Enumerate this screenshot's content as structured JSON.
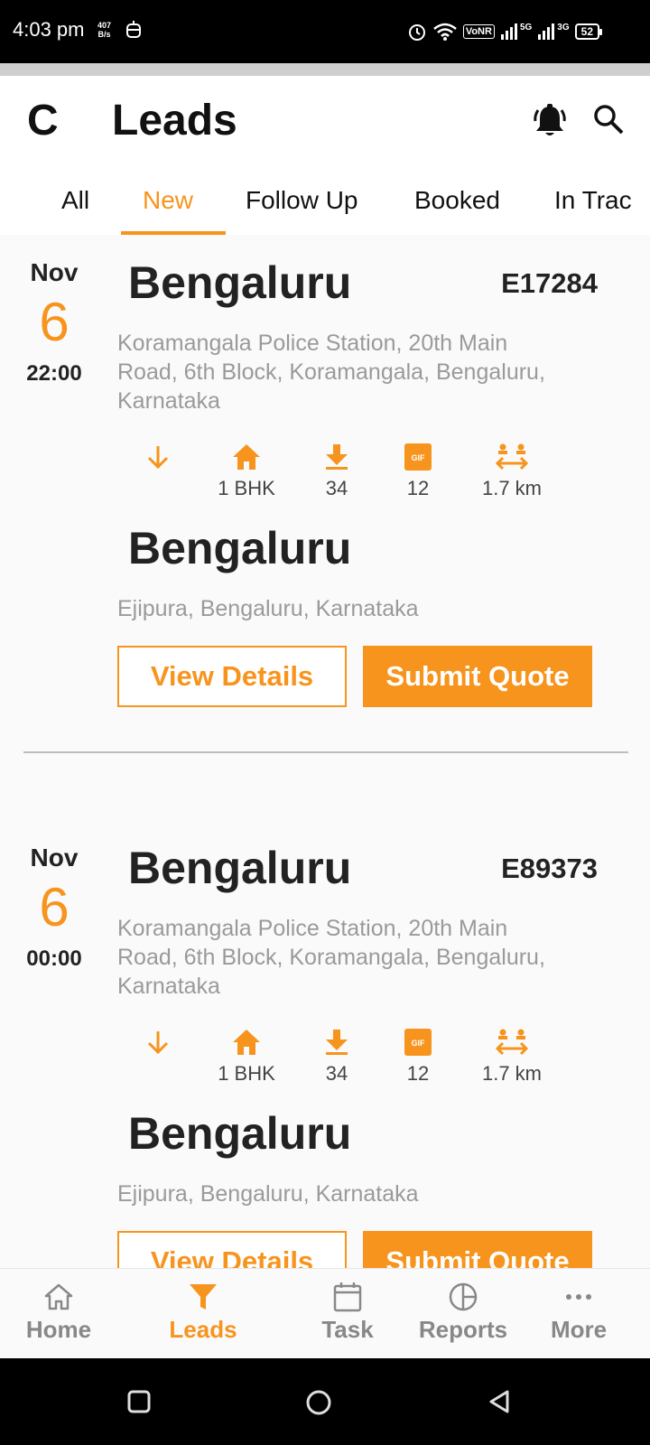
{
  "status_bar": {
    "time": "4:03 pm",
    "net_speed_value": "407",
    "net_speed_unit": "B/s",
    "vonr": "VoNR",
    "sig1": "5G",
    "sig2": "3G",
    "battery": "52"
  },
  "header": {
    "logo": "C",
    "title": "Leads",
    "icons": [
      "bell-icon",
      "search-icon"
    ]
  },
  "tabs": [
    {
      "label": "All",
      "active": false
    },
    {
      "label": "New",
      "active": true
    },
    {
      "label": "Follow Up",
      "active": false
    },
    {
      "label": "Booked",
      "active": false
    },
    {
      "label": "In Trac",
      "active": false
    }
  ],
  "leads": [
    {
      "month": "Nov",
      "day": "6",
      "time": "22:00",
      "from_city": "Bengaluru",
      "id": "E17284",
      "from_address": "Koramangala Police Station, 20th Main Road, 6th Block, Koramangala, Bengaluru, Karnataka",
      "stats": {
        "home": "1 BHK",
        "download": "34",
        "gif": "12",
        "distance": "1.7 km"
      },
      "to_city": "Bengaluru",
      "to_address": "Ejipura, Bengaluru, Karnataka",
      "view_label": "View Details",
      "quote_label": "Submit Quote"
    },
    {
      "month": "Nov",
      "day": "6",
      "time": "00:00",
      "from_city": "Bengaluru",
      "id": "E89373",
      "from_address": "Koramangala Police Station, 20th Main Road, 6th Block, Koramangala, Bengaluru, Karnataka",
      "stats": {
        "home": "1 BHK",
        "download": "34",
        "gif": "12",
        "distance": "1.7 km"
      },
      "to_city": "Bengaluru",
      "to_address": "Ejipura, Bengaluru, Karnataka",
      "view_label": "View Details",
      "quote_label": "Submit Quote"
    }
  ],
  "gif_badge": "GIF",
  "bottom_nav": [
    {
      "label": "Home",
      "icon": "home-icon",
      "active": false
    },
    {
      "label": "Leads",
      "icon": "filter-icon",
      "active": true
    },
    {
      "label": "Task",
      "icon": "calendar-icon",
      "active": false
    },
    {
      "label": "Reports",
      "icon": "pie-chart-icon",
      "active": false
    },
    {
      "label": "More",
      "icon": "more-dots-icon",
      "active": false
    }
  ],
  "colors": {
    "accent": "#f7941d",
    "text": "#222222",
    "muted": "#9a9a9a"
  }
}
